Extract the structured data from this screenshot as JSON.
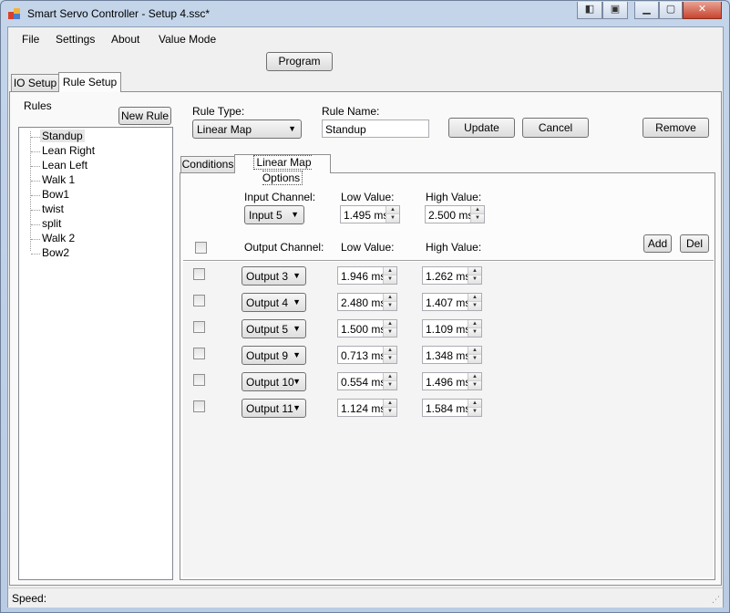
{
  "window": {
    "title": "Smart Servo Controller - Setup 4.ssc*"
  },
  "menu": {
    "items": [
      "File",
      "Settings",
      "About",
      "Value Mode"
    ]
  },
  "toolbar": {
    "program_label": "Program"
  },
  "tabs": {
    "io_setup": "IO Setup",
    "rule_setup": "Rule Setup"
  },
  "rules": {
    "label": "Rules",
    "new_rule_label": "New Rule",
    "items": [
      "Standup",
      "Lean Right",
      "Lean Left",
      "Walk 1",
      "Bow1",
      "twist",
      "split",
      "Walk 2",
      "Bow2"
    ],
    "selected": "Standup"
  },
  "rule_form": {
    "type_label": "Rule Type:",
    "type_value": "Linear Map",
    "name_label": "Rule Name:",
    "name_value": "Standup",
    "update_label": "Update",
    "cancel_label": "Cancel",
    "remove_label": "Remove"
  },
  "subtabs": {
    "conditions": "Conditions",
    "linear_map": "Linear Map Options"
  },
  "linear_map": {
    "input_channel_label": "Input Channel:",
    "low_value_label": "Low Value:",
    "high_value_label": "High Value:",
    "input_channel": "Input 5",
    "input_low": "1.495 ms",
    "input_high": "2.500 ms",
    "output_channel_label": "Output Channel:",
    "add_label": "Add",
    "del_label": "Del",
    "outputs": [
      {
        "channel": "Output 3",
        "low": "1.946 ms",
        "high": "1.262 ms"
      },
      {
        "channel": "Output 4",
        "low": "2.480 ms",
        "high": "1.407 ms"
      },
      {
        "channel": "Output 5",
        "low": "1.500 ms",
        "high": "1.109 ms"
      },
      {
        "channel": "Output 9",
        "low": "0.713 ms",
        "high": "1.348 ms"
      },
      {
        "channel": "Output 10",
        "low": "0.554 ms",
        "high": "1.496 ms"
      },
      {
        "channel": "Output 11",
        "low": "1.124 ms",
        "high": "1.584 ms"
      }
    ]
  },
  "status": {
    "speed_label": "Speed:"
  }
}
